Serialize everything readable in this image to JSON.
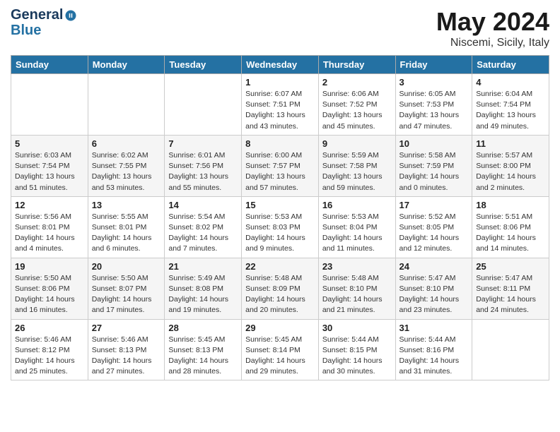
{
  "header": {
    "logo_line1": "General",
    "logo_line2": "Blue",
    "month": "May 2024",
    "location": "Niscemi, Sicily, Italy"
  },
  "weekdays": [
    "Sunday",
    "Monday",
    "Tuesday",
    "Wednesday",
    "Thursday",
    "Friday",
    "Saturday"
  ],
  "weeks": [
    [
      {
        "day": "",
        "info": ""
      },
      {
        "day": "",
        "info": ""
      },
      {
        "day": "",
        "info": ""
      },
      {
        "day": "1",
        "info": "Sunrise: 6:07 AM\nSunset: 7:51 PM\nDaylight: 13 hours\nand 43 minutes."
      },
      {
        "day": "2",
        "info": "Sunrise: 6:06 AM\nSunset: 7:52 PM\nDaylight: 13 hours\nand 45 minutes."
      },
      {
        "day": "3",
        "info": "Sunrise: 6:05 AM\nSunset: 7:53 PM\nDaylight: 13 hours\nand 47 minutes."
      },
      {
        "day": "4",
        "info": "Sunrise: 6:04 AM\nSunset: 7:54 PM\nDaylight: 13 hours\nand 49 minutes."
      }
    ],
    [
      {
        "day": "5",
        "info": "Sunrise: 6:03 AM\nSunset: 7:54 PM\nDaylight: 13 hours\nand 51 minutes."
      },
      {
        "day": "6",
        "info": "Sunrise: 6:02 AM\nSunset: 7:55 PM\nDaylight: 13 hours\nand 53 minutes."
      },
      {
        "day": "7",
        "info": "Sunrise: 6:01 AM\nSunset: 7:56 PM\nDaylight: 13 hours\nand 55 minutes."
      },
      {
        "day": "8",
        "info": "Sunrise: 6:00 AM\nSunset: 7:57 PM\nDaylight: 13 hours\nand 57 minutes."
      },
      {
        "day": "9",
        "info": "Sunrise: 5:59 AM\nSunset: 7:58 PM\nDaylight: 13 hours\nand 59 minutes."
      },
      {
        "day": "10",
        "info": "Sunrise: 5:58 AM\nSunset: 7:59 PM\nDaylight: 14 hours\nand 0 minutes."
      },
      {
        "day": "11",
        "info": "Sunrise: 5:57 AM\nSunset: 8:00 PM\nDaylight: 14 hours\nand 2 minutes."
      }
    ],
    [
      {
        "day": "12",
        "info": "Sunrise: 5:56 AM\nSunset: 8:01 PM\nDaylight: 14 hours\nand 4 minutes."
      },
      {
        "day": "13",
        "info": "Sunrise: 5:55 AM\nSunset: 8:01 PM\nDaylight: 14 hours\nand 6 minutes."
      },
      {
        "day": "14",
        "info": "Sunrise: 5:54 AM\nSunset: 8:02 PM\nDaylight: 14 hours\nand 7 minutes."
      },
      {
        "day": "15",
        "info": "Sunrise: 5:53 AM\nSunset: 8:03 PM\nDaylight: 14 hours\nand 9 minutes."
      },
      {
        "day": "16",
        "info": "Sunrise: 5:53 AM\nSunset: 8:04 PM\nDaylight: 14 hours\nand 11 minutes."
      },
      {
        "day": "17",
        "info": "Sunrise: 5:52 AM\nSunset: 8:05 PM\nDaylight: 14 hours\nand 12 minutes."
      },
      {
        "day": "18",
        "info": "Sunrise: 5:51 AM\nSunset: 8:06 PM\nDaylight: 14 hours\nand 14 minutes."
      }
    ],
    [
      {
        "day": "19",
        "info": "Sunrise: 5:50 AM\nSunset: 8:06 PM\nDaylight: 14 hours\nand 16 minutes."
      },
      {
        "day": "20",
        "info": "Sunrise: 5:50 AM\nSunset: 8:07 PM\nDaylight: 14 hours\nand 17 minutes."
      },
      {
        "day": "21",
        "info": "Sunrise: 5:49 AM\nSunset: 8:08 PM\nDaylight: 14 hours\nand 19 minutes."
      },
      {
        "day": "22",
        "info": "Sunrise: 5:48 AM\nSunset: 8:09 PM\nDaylight: 14 hours\nand 20 minutes."
      },
      {
        "day": "23",
        "info": "Sunrise: 5:48 AM\nSunset: 8:10 PM\nDaylight: 14 hours\nand 21 minutes."
      },
      {
        "day": "24",
        "info": "Sunrise: 5:47 AM\nSunset: 8:10 PM\nDaylight: 14 hours\nand 23 minutes."
      },
      {
        "day": "25",
        "info": "Sunrise: 5:47 AM\nSunset: 8:11 PM\nDaylight: 14 hours\nand 24 minutes."
      }
    ],
    [
      {
        "day": "26",
        "info": "Sunrise: 5:46 AM\nSunset: 8:12 PM\nDaylight: 14 hours\nand 25 minutes."
      },
      {
        "day": "27",
        "info": "Sunrise: 5:46 AM\nSunset: 8:13 PM\nDaylight: 14 hours\nand 27 minutes."
      },
      {
        "day": "28",
        "info": "Sunrise: 5:45 AM\nSunset: 8:13 PM\nDaylight: 14 hours\nand 28 minutes."
      },
      {
        "day": "29",
        "info": "Sunrise: 5:45 AM\nSunset: 8:14 PM\nDaylight: 14 hours\nand 29 minutes."
      },
      {
        "day": "30",
        "info": "Sunrise: 5:44 AM\nSunset: 8:15 PM\nDaylight: 14 hours\nand 30 minutes."
      },
      {
        "day": "31",
        "info": "Sunrise: 5:44 AM\nSunset: 8:16 PM\nDaylight: 14 hours\nand 31 minutes."
      },
      {
        "day": "",
        "info": ""
      }
    ]
  ]
}
